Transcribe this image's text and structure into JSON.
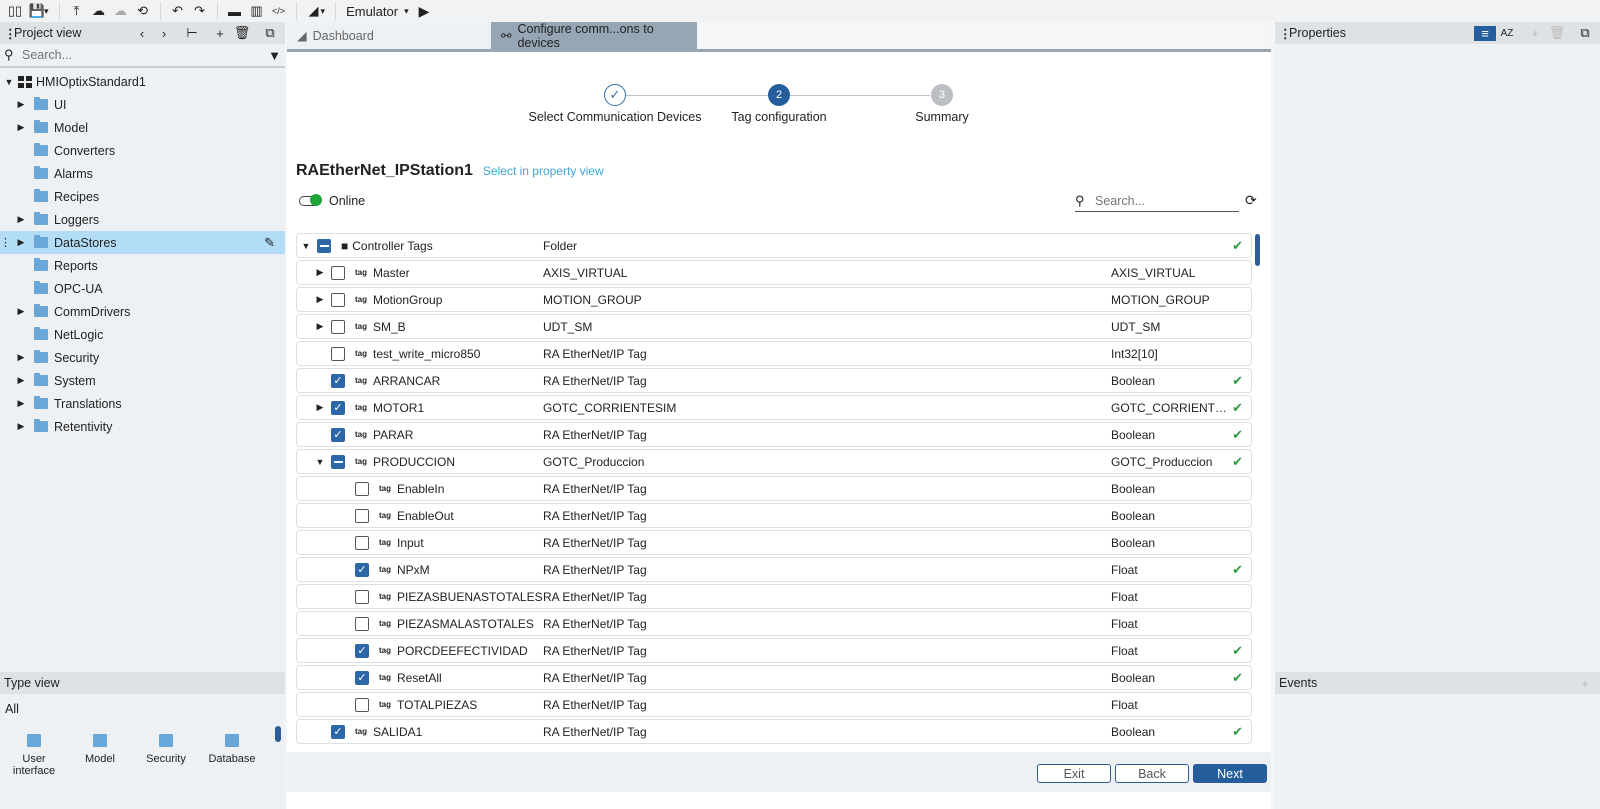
{
  "toolbar": {
    "emulator_label": "Emulator",
    "icons": [
      "layout-icon",
      "save-icon",
      "upload-project-icon",
      "cloud-upload-icon",
      "cloud-download-icon",
      "history-icon",
      "undo-icon",
      "redo-icon",
      "open-folder-icon",
      "library-icon",
      "code-icon",
      "theme-icon",
      "run-icon"
    ]
  },
  "project_view": {
    "title": "Project view",
    "search_placeholder": "Search...",
    "root": "HMIOptixStandard1",
    "items": [
      {
        "label": "UI",
        "expandable": true
      },
      {
        "label": "Model",
        "expandable": true
      },
      {
        "label": "Converters",
        "expandable": false
      },
      {
        "label": "Alarms",
        "expandable": false
      },
      {
        "label": "Recipes",
        "expandable": false
      },
      {
        "label": "Loggers",
        "expandable": true
      },
      {
        "label": "DataStores",
        "expandable": true,
        "selected": true
      },
      {
        "label": "Reports",
        "expandable": false
      },
      {
        "label": "OPC-UA",
        "expandable": false
      },
      {
        "label": "CommDrivers",
        "expandable": true
      },
      {
        "label": "NetLogic",
        "expandable": false
      },
      {
        "label": "Security",
        "expandable": true
      },
      {
        "label": "System",
        "expandable": true
      },
      {
        "label": "Translations",
        "expandable": true
      },
      {
        "label": "Retentivity",
        "expandable": true
      }
    ]
  },
  "type_view": {
    "title": "Type view",
    "filter": "All",
    "items": [
      "User interface",
      "Model",
      "Security",
      "Database"
    ]
  },
  "tabs": [
    {
      "label": "Dashboard",
      "active": false
    },
    {
      "label": "Configure comm...ons to devices",
      "active": true
    }
  ],
  "wizard": {
    "steps": [
      {
        "number": "1",
        "label": "Select Communication Devices",
        "state": "done"
      },
      {
        "number": "2",
        "label": "Tag configuration",
        "state": "current"
      },
      {
        "number": "3",
        "label": "Summary",
        "state": "pending"
      }
    ],
    "device_name": "RAEtherNet_IPStation1",
    "select_link": "Select in property view",
    "online_label": "Online",
    "online": true,
    "search_placeholder": "Search...",
    "rows": [
      {
        "name": "Controller Tags",
        "type": "Folder",
        "dtype": "",
        "check": "partial",
        "expand": "open",
        "level": 0,
        "folder": true,
        "synced": true
      },
      {
        "name": "Master",
        "type": "AXIS_VIRTUAL",
        "dtype": "AXIS_VIRTUAL",
        "check": "none",
        "expand": "closed",
        "level": 1,
        "synced": false
      },
      {
        "name": "MotionGroup",
        "type": "MOTION_GROUP",
        "dtype": "MOTION_GROUP",
        "check": "none",
        "expand": "closed",
        "level": 1,
        "synced": false
      },
      {
        "name": "SM_B",
        "type": "UDT_SM",
        "dtype": "UDT_SM",
        "check": "none",
        "expand": "closed",
        "level": 1,
        "synced": false
      },
      {
        "name": "test_write_micro850",
        "type": "RA EtherNet/IP Tag",
        "dtype": "Int32[10]",
        "check": "none",
        "expand": "",
        "level": 1,
        "synced": false
      },
      {
        "name": "ARRANCAR",
        "type": "RA EtherNet/IP Tag",
        "dtype": "Boolean",
        "check": "checked",
        "expand": "",
        "level": 1,
        "synced": true
      },
      {
        "name": "MOTOR1",
        "type": "GOTC_CORRIENTESIM",
        "dtype": "GOTC_CORRIENTESIM",
        "check": "checked",
        "expand": "closed",
        "level": 1,
        "synced": true
      },
      {
        "name": "PARAR",
        "type": "RA EtherNet/IP Tag",
        "dtype": "Boolean",
        "check": "checked",
        "expand": "",
        "level": 1,
        "synced": true
      },
      {
        "name": "PRODUCCION",
        "type": "GOTC_Produccion",
        "dtype": "GOTC_Produccion",
        "check": "partial",
        "expand": "open",
        "level": 1,
        "synced": true
      },
      {
        "name": "EnableIn",
        "type": "RA EtherNet/IP Tag",
        "dtype": "Boolean",
        "check": "none",
        "expand": "",
        "level": 2,
        "synced": false
      },
      {
        "name": "EnableOut",
        "type": "RA EtherNet/IP Tag",
        "dtype": "Boolean",
        "check": "none",
        "expand": "",
        "level": 2,
        "synced": false
      },
      {
        "name": "Input",
        "type": "RA EtherNet/IP Tag",
        "dtype": "Boolean",
        "check": "none",
        "expand": "",
        "level": 2,
        "synced": false
      },
      {
        "name": "NPxM",
        "type": "RA EtherNet/IP Tag",
        "dtype": "Float",
        "check": "checked",
        "expand": "",
        "level": 2,
        "synced": true
      },
      {
        "name": "PIEZASBUENASTOTALES",
        "type": "RA EtherNet/IP Tag",
        "dtype": "Float",
        "check": "none",
        "expand": "",
        "level": 2,
        "synced": false
      },
      {
        "name": "PIEZASMALASTOTALES",
        "type": "RA EtherNet/IP Tag",
        "dtype": "Float",
        "check": "none",
        "expand": "",
        "level": 2,
        "synced": false
      },
      {
        "name": "PORCDEEFECTIVIDAD",
        "type": "RA EtherNet/IP Tag",
        "dtype": "Float",
        "check": "checked",
        "expand": "",
        "level": 2,
        "synced": true
      },
      {
        "name": "ResetAll",
        "type": "RA EtherNet/IP Tag",
        "dtype": "Boolean",
        "check": "checked",
        "expand": "",
        "level": 2,
        "synced": true
      },
      {
        "name": "TOTALPIEZAS",
        "type": "RA EtherNet/IP Tag",
        "dtype": "Float",
        "check": "none",
        "expand": "",
        "level": 2,
        "synced": false
      },
      {
        "name": "SALIDA1",
        "type": "RA EtherNet/IP Tag",
        "dtype": "Boolean",
        "check": "checked",
        "expand": "",
        "level": 1,
        "synced": true
      }
    ],
    "tag_badge": "tag",
    "buttons": {
      "exit": "Exit",
      "back": "Back",
      "next": "Next"
    }
  },
  "properties": {
    "title": "Properties"
  },
  "events": {
    "title": "Events"
  }
}
